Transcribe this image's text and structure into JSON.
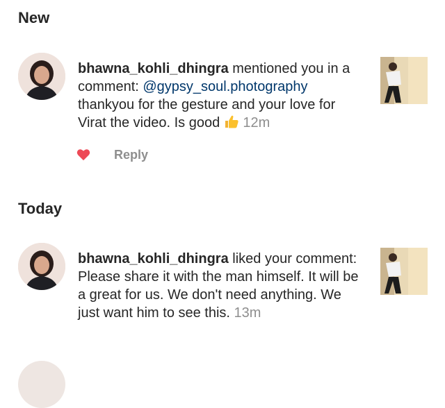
{
  "sections": {
    "new": {
      "title": "New"
    },
    "today": {
      "title": "Today"
    }
  },
  "notifications": [
    {
      "username": "bhawna_kohli_dhingra",
      "action": " mentioned you in a comment: ",
      "mention": "@gypsy_soul.photography",
      "body": " thankyou for the gesture and your love for Virat the video. Is good ",
      "emoji": "thumbs-up-emoji",
      "time": "12m",
      "has_actions": true,
      "reply_label": "Reply",
      "like_icon": "heart-icon",
      "like_color": "#ed4956"
    },
    {
      "username": "bhawna_kohli_dhingra",
      "action": " liked your comment: Please share it with the man himself. It will be a great for us. We don't need anything. We just want him to see this. ",
      "time": "13m",
      "has_actions": false
    }
  ],
  "colors": {
    "text": "#262626",
    "secondary": "#8e8e8e",
    "mention": "#00376b",
    "like": "#ed4956"
  }
}
